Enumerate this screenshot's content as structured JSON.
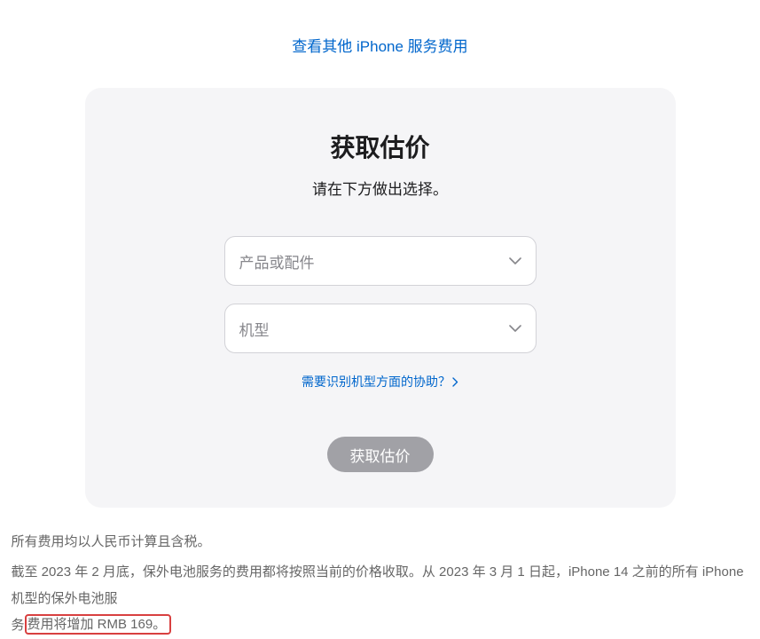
{
  "topLink": "查看其他 iPhone 服务费用",
  "card": {
    "title": "获取估价",
    "subtitle": "请在下方做出选择。",
    "select1Placeholder": "产品或配件",
    "select2Placeholder": "机型",
    "helpLink": "需要识别机型方面的协助？",
    "submit": "获取估价"
  },
  "footer": {
    "line1": "所有费用均以人民币计算且含税。",
    "line2a": "截至 2023 年 2 月底，保外电池服务的费用都将按照当前的价格收取。从 2023 年 3 月 1 日起，iPhone 14 之前的所有 iPhone 机型的保外电池服",
    "line2b": "务",
    "highlight": "费用将增加 RMB 169。"
  }
}
